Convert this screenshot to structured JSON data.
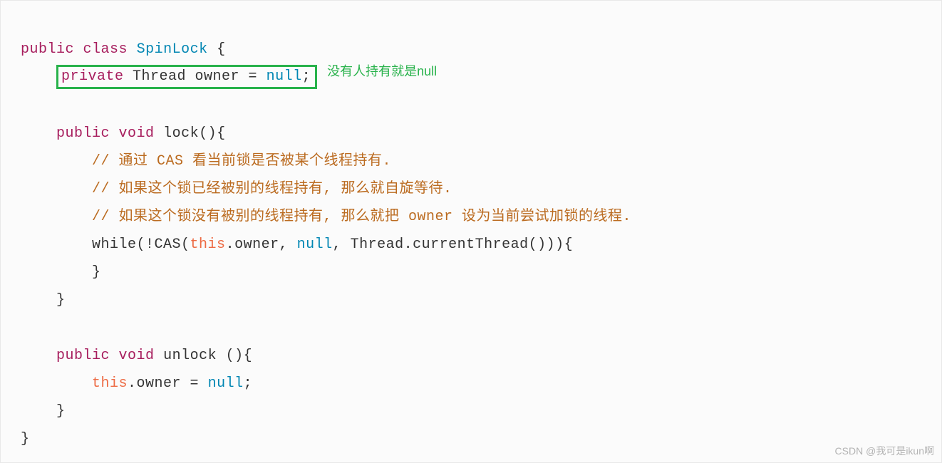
{
  "code": {
    "line1": {
      "kw1": "public",
      "kw2": "class",
      "cls": "SpinLock",
      "brace": " {"
    },
    "line2": {
      "kw": "private",
      "type": " Thread owner = ",
      "lit": "null",
      "semi": ";"
    },
    "annot": "没有人持有就是null",
    "line4": {
      "kw1": "public",
      "kw2": "void",
      "name": " lock(){",
      "sp": " "
    },
    "c1": "// 通过 CAS 看当前锁是否被某个线程持有.",
    "c2": "// 如果这个锁已经被别的线程持有, 那么就自旋等待.",
    "c3": "// 如果这个锁没有被别的线程持有, 那么就把 owner 设为当前尝试加锁的线程.",
    "while": {
      "pre": "while(!CAS(",
      "this": "this",
      "mid1": ".owner, ",
      "null": "null",
      "mid2": ", Thread.currentThread())){"
    },
    "closeInnerWhile": "}",
    "closeLock": "}",
    "unlock": {
      "kw1": "public",
      "kw2": "void",
      "name": " unlock (){",
      "sp": " "
    },
    "assign": {
      "this": "this",
      "rest": ".owner = ",
      "null": "null",
      "semi": ";"
    },
    "closeUnlock": "}",
    "closeClass": "}"
  },
  "watermark": "CSDN @我可是ikun啊"
}
